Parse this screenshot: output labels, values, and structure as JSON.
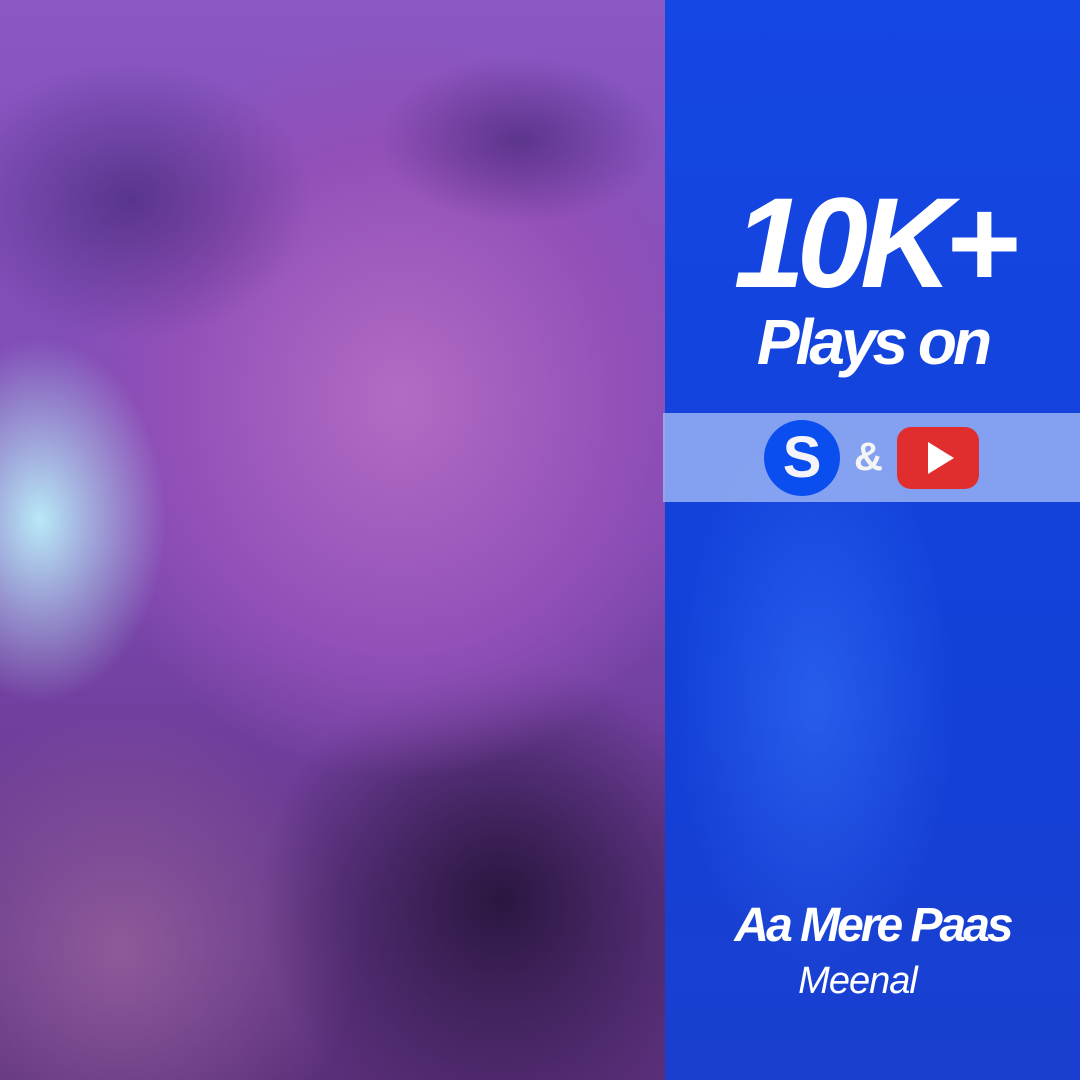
{
  "stat": {
    "count": "10K+",
    "subtitle": "Plays on"
  },
  "platforms": {
    "first_logo_letter": "S",
    "separator": "&",
    "second": "youtube-play-icon",
    "youtube_color": "#e02e2e",
    "s_color": "#0a4ef0"
  },
  "song": {
    "title": "Aa Mere Paas",
    "artist": "Meenal"
  },
  "colors": {
    "panel": "#1346e0"
  }
}
